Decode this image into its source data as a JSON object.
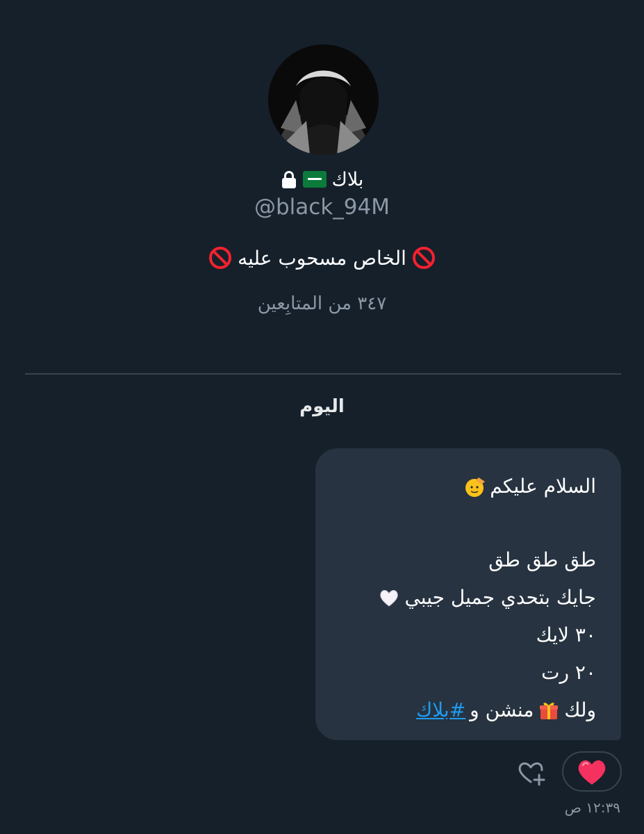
{
  "profile": {
    "display_name": "بلاك",
    "flag_icon": "saudi-flag-icon",
    "lock_icon": "lock-icon",
    "username": "@black_94M",
    "bio": "الخاص مسحوب عليه",
    "bio_icon": "no-entry-icon",
    "followers": "٣٤٧ من المتابِعين"
  },
  "conversation": {
    "day_label": "اليوم",
    "message": {
      "line1": "السلام عليكم",
      "line1_emoji": "saluting-face-emoji",
      "line2": "طق طق طق",
      "line3": "جايك بتحدي جميل جيبي",
      "line3_emoji": "white-heart-emoji",
      "line4": "٣٠ لايك",
      "line5": "٢٠ رت",
      "line6_start": "ولك",
      "line6_emoji": "gift-emoji",
      "line6_mid": "منشن و",
      "hashtag": "#بلاك"
    },
    "reaction_emoji": "red-heart-emoji",
    "add_reaction_icon": "heart-plus-icon",
    "timestamp": "١٢:٣٩ ص"
  },
  "colors": {
    "background": "#16202b",
    "bubble": "#273340",
    "muted_text": "#8b98a5",
    "link": "#1d9bf0"
  }
}
